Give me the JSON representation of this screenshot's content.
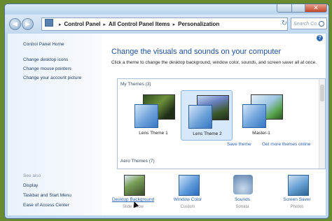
{
  "window": {
    "close_glyph": "✕",
    "back_glyph": "◀",
    "forward_glyph": "▶",
    "refresh_glyph": "↻",
    "search_placeholder": "Search Co..."
  },
  "breadcrumb": [
    "Control Panel",
    "All Control Panel Items",
    "Personalization"
  ],
  "sidebar": {
    "links": [
      "Control Panel Home",
      "Change desktop icons",
      "Change mouse pointers",
      "Change your account picture"
    ],
    "see_also_title": "See also",
    "see_also": [
      "Display",
      "Taskbar and Start Menu",
      "Ease of Access Center"
    ]
  },
  "main": {
    "heading": "Change the visuals and sounds on your computer",
    "description": "Click a theme to change the desktop background, window color, sounds, and screen saver all at once.",
    "my_themes_label": "My Themes (3)",
    "aero_themes_label": "Aero Themes (7)",
    "themes": [
      "Lens Theme 1",
      "Lens Theme 2",
      "Master-1"
    ],
    "selected_theme": "Lens Theme 2",
    "save_theme": "Save theme",
    "get_more_online": "Get more themes online"
  },
  "options": [
    {
      "label": "Desktop Background",
      "sub": "Slide Show",
      "icon": "desktop-background-icon"
    },
    {
      "label": "Window Color",
      "sub": "Custom",
      "icon": "window-color-icon"
    },
    {
      "label": "Sounds",
      "sub": "Sonata",
      "icon": "sounds-icon"
    },
    {
      "label": "Screen Saver",
      "sub": "Photos",
      "icon": "screen-saver-icon"
    }
  ]
}
